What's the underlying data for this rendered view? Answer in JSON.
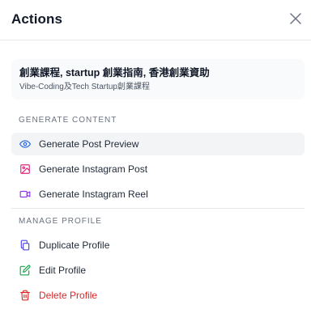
{
  "dialog": {
    "title": "Actions",
    "close_icon": "close-icon"
  },
  "profile": {
    "name": "創業課程, startup 創業指南, 香港創業資助",
    "subtitle": "Vibe-Coding及Tech Startup創業課程"
  },
  "sections": {
    "generate_label": "GENERATE CONTENT",
    "manage_label": "MANAGE PROFILE"
  },
  "generate_items": [
    {
      "label": "Generate Post Preview",
      "icon": "eye-icon",
      "color": "#2563eb",
      "active": true
    },
    {
      "label": "Generate Instagram Post",
      "icon": "image-icon",
      "color": "#db2777",
      "active": false
    },
    {
      "label": "Generate Instagram Reel",
      "icon": "video-icon",
      "color": "#9333ea",
      "active": false
    }
  ],
  "manage_items": [
    {
      "label": "Duplicate Profile",
      "icon": "duplicate-icon",
      "color": "#4f46e5"
    },
    {
      "label": "Edit Profile",
      "icon": "edit-icon",
      "color": "#16a34a"
    },
    {
      "label": "Delete Profile",
      "icon": "trash-icon",
      "color": "#dc2626"
    }
  ]
}
